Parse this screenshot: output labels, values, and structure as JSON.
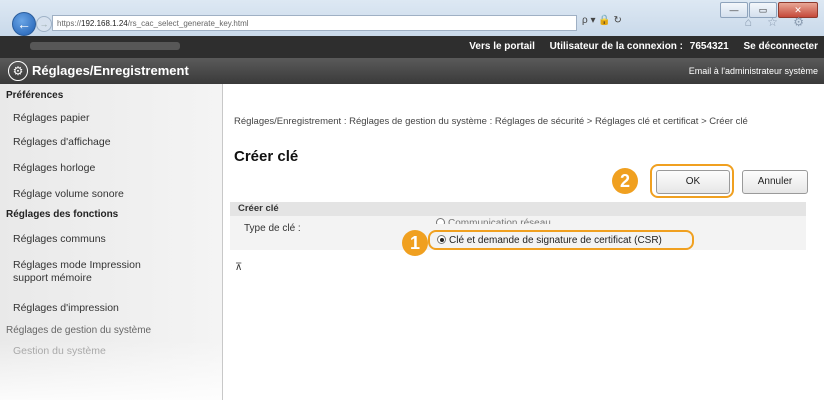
{
  "browser": {
    "url_prefix": "https://",
    "url_host": "192.168.1.24",
    "url_path": "/rs_cac_select_generate_key.html",
    "address_icons": "ρ ▾ 🔒 ↻",
    "window_buttons": {
      "minimize": "—",
      "maximize": "▭",
      "close": "✕"
    },
    "toolbar_icons": "⌂ ☆ ⚙"
  },
  "topbar": {
    "portal_link": "Vers le portail",
    "user_label": "Utilisateur de la connexion :",
    "user_id": "7654321",
    "logout_link": "Se déconnecter"
  },
  "header": {
    "title": "Réglages/Enregistrement",
    "admin_mail": "Email à l'administrateur système"
  },
  "sidebar": {
    "groups": [
      {
        "heading": "Préférences",
        "items": [
          "Réglages papier",
          "Réglages d'affichage",
          "Réglages horloge",
          "Réglage volume sonore"
        ]
      },
      {
        "heading": "Réglages des fonctions",
        "items": [
          "Réglages communs",
          "Réglages mode Impression support mémoire",
          "Réglages d'impression"
        ]
      },
      {
        "heading": "Réglages de gestion du système",
        "items": [
          "Gestion du système"
        ]
      }
    ]
  },
  "main": {
    "breadcrumb": "Réglages/Enregistrement : Réglages de gestion du système : Réglages de sécurité > Réglages clé et certificat > Créer clé",
    "page_title": "Créer clé",
    "ok_label": "OK",
    "cancel_label": "Annuler",
    "section_title": "Créer clé",
    "key_type_label": "Type de clé :",
    "options": [
      {
        "label": "Communication réseau",
        "selected": false
      },
      {
        "label": "Clé et demande de signature de certificat (CSR)",
        "selected": true
      }
    ],
    "to_top": "⊼"
  },
  "callouts": {
    "first": "1",
    "second": "2"
  },
  "colors": {
    "highlight": "#f0a020",
    "header_bg": "#3a3a3a"
  }
}
